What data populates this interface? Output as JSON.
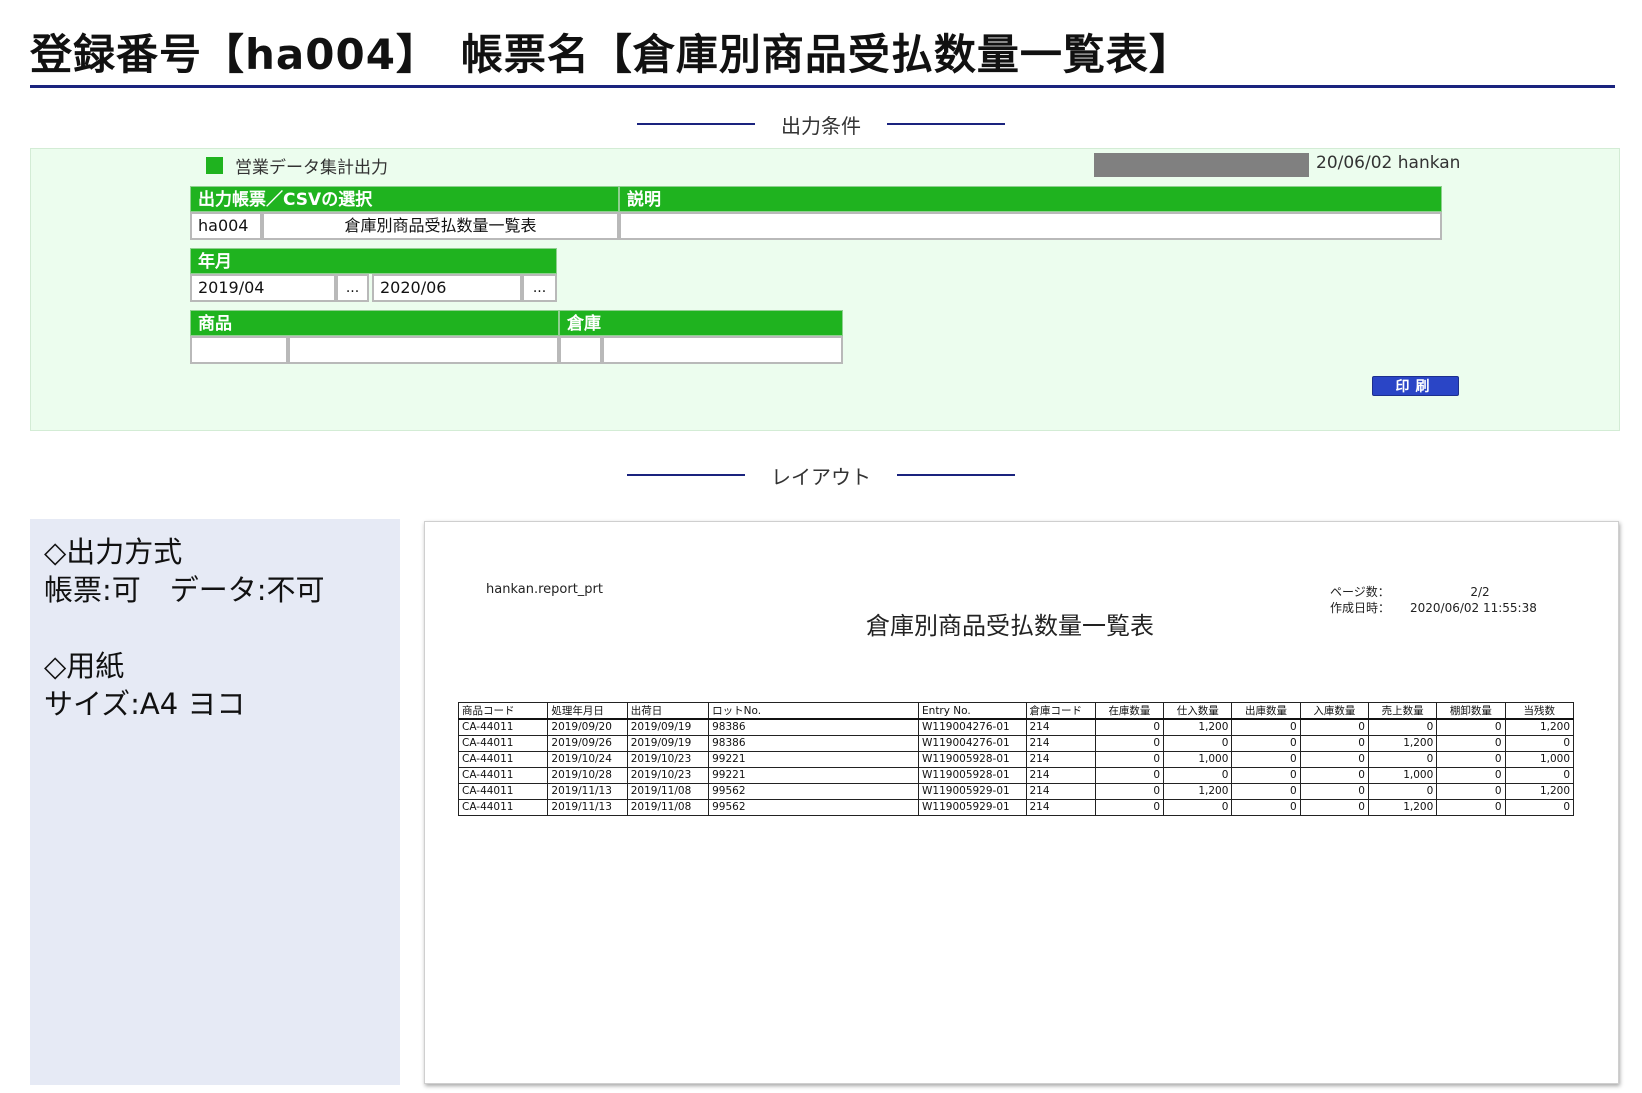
{
  "header": {
    "title": "登録番号【ha004】　帳票名【倉庫別商品受払数量一覧表】"
  },
  "sections": {
    "output_conditions": "出力条件",
    "layout": "レイアウト"
  },
  "conditions_panel": {
    "menu_label": "営業データ集計出力",
    "date_user": "20/06/02 hankan",
    "report_select": {
      "header_left": "出力帳票／CSVの選択",
      "header_right": "説明",
      "code": "ha004",
      "name": "倉庫別商品受払数量一覧表",
      "description": ""
    },
    "year_month": {
      "header": "年月",
      "from": "2019/04",
      "from_button": "...",
      "to": "2020/06",
      "to_button": "..."
    },
    "product": {
      "header": "商品",
      "code": "",
      "name": ""
    },
    "warehouse": {
      "header": "倉庫",
      "code": "",
      "name": ""
    },
    "print_button": "印刷"
  },
  "spec": {
    "output_method_heading": "◇出力方式",
    "output_method_value": "帳票:可　データ:不可",
    "paper_heading": "◇用紙",
    "paper_value": "サイズ:A4 ヨコ"
  },
  "preview": {
    "program_name": "hankan.report_prt",
    "title": "倉庫別商品受払数量一覧表",
    "page_label": "ページ数：",
    "page_value": "2/2",
    "created_label": "作成日時：",
    "created_value": "2020/06/02 11:55:38",
    "columns": [
      "商品コード",
      "処理年月日",
      "出荷日",
      "ロットNo.",
      "Entry No.",
      "倉庫コード",
      "在庫数量",
      "仕入数量",
      "出庫数量",
      "入庫数量",
      "売上数量",
      "棚卸数量",
      "当残数"
    ],
    "rows": [
      [
        "CA-44011",
        "2019/09/20",
        "2019/09/19",
        "98386",
        "W119004276-01",
        "214",
        "0",
        "1,200",
        "0",
        "0",
        "0",
        "0",
        "1,200"
      ],
      [
        "CA-44011",
        "2019/09/26",
        "2019/09/19",
        "98386",
        "W119004276-01",
        "214",
        "0",
        "0",
        "0",
        "0",
        "1,200",
        "0",
        "0"
      ],
      [
        "CA-44011",
        "2019/10/24",
        "2019/10/23",
        "99221",
        "W119005928-01",
        "214",
        "0",
        "1,000",
        "0",
        "0",
        "0",
        "0",
        "1,000"
      ],
      [
        "CA-44011",
        "2019/10/28",
        "2019/10/23",
        "99221",
        "W119005928-01",
        "214",
        "0",
        "0",
        "0",
        "0",
        "1,000",
        "0",
        "0"
      ],
      [
        "CA-44011",
        "2019/11/13",
        "2019/11/08",
        "99562",
        "W119005929-01",
        "214",
        "0",
        "1,200",
        "0",
        "0",
        "0",
        "0",
        "1,200"
      ],
      [
        "CA-44011",
        "2019/11/13",
        "2019/11/08",
        "99562",
        "W119005929-01",
        "214",
        "0",
        "0",
        "0",
        "0",
        "1,200",
        "0",
        "0"
      ]
    ]
  },
  "colors": {
    "accent_navy": "#1a237e",
    "header_green": "#1fb31f",
    "panel_green": "#ecfdee",
    "spec_panel": "#e6eaf5",
    "print_button": "#2a45c6"
  }
}
